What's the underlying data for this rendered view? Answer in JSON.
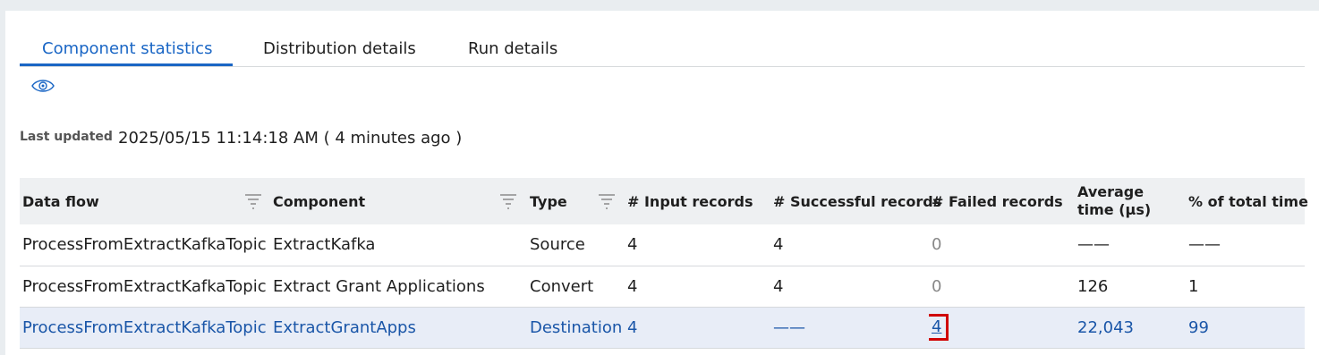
{
  "tabs": [
    {
      "label": "Component statistics",
      "active": true
    },
    {
      "label": "Distribution details",
      "active": false
    },
    {
      "label": "Run details",
      "active": false
    }
  ],
  "icons": {
    "view": "eye-icon",
    "filter": "filter-icon"
  },
  "last_updated": {
    "label": "Last updated",
    "value": "2025/05/15 11:14:18 AM ( 4 minutes ago )"
  },
  "table": {
    "columns": [
      "Data flow",
      "Component",
      "Type",
      "# Input records",
      "# Successful records",
      "# Failed records",
      "Average time (µs)",
      "% of total time"
    ],
    "rows": [
      {
        "data_flow": "ProcessFromExtractKafkaTopic",
        "component": "ExtractKafka",
        "type": "Source",
        "input": "4",
        "successful": "4",
        "failed": "0",
        "avg_time": "——",
        "pct": "——"
      },
      {
        "data_flow": "ProcessFromExtractKafkaTopic",
        "component": "Extract Grant Applications",
        "type": "Convert",
        "input": "4",
        "successful": "4",
        "failed": "0",
        "avg_time": "126",
        "pct": "1"
      },
      {
        "data_flow": "ProcessFromExtractKafkaTopic",
        "component": "ExtractGrantApps",
        "type": "Destination",
        "input": "4",
        "successful": "——",
        "failed": "4",
        "avg_time": "22,043",
        "pct": "99"
      }
    ]
  },
  "colors": {
    "accent": "#1a66c5",
    "selected_row": "#e8edf7",
    "highlight_box": "#d00000"
  }
}
